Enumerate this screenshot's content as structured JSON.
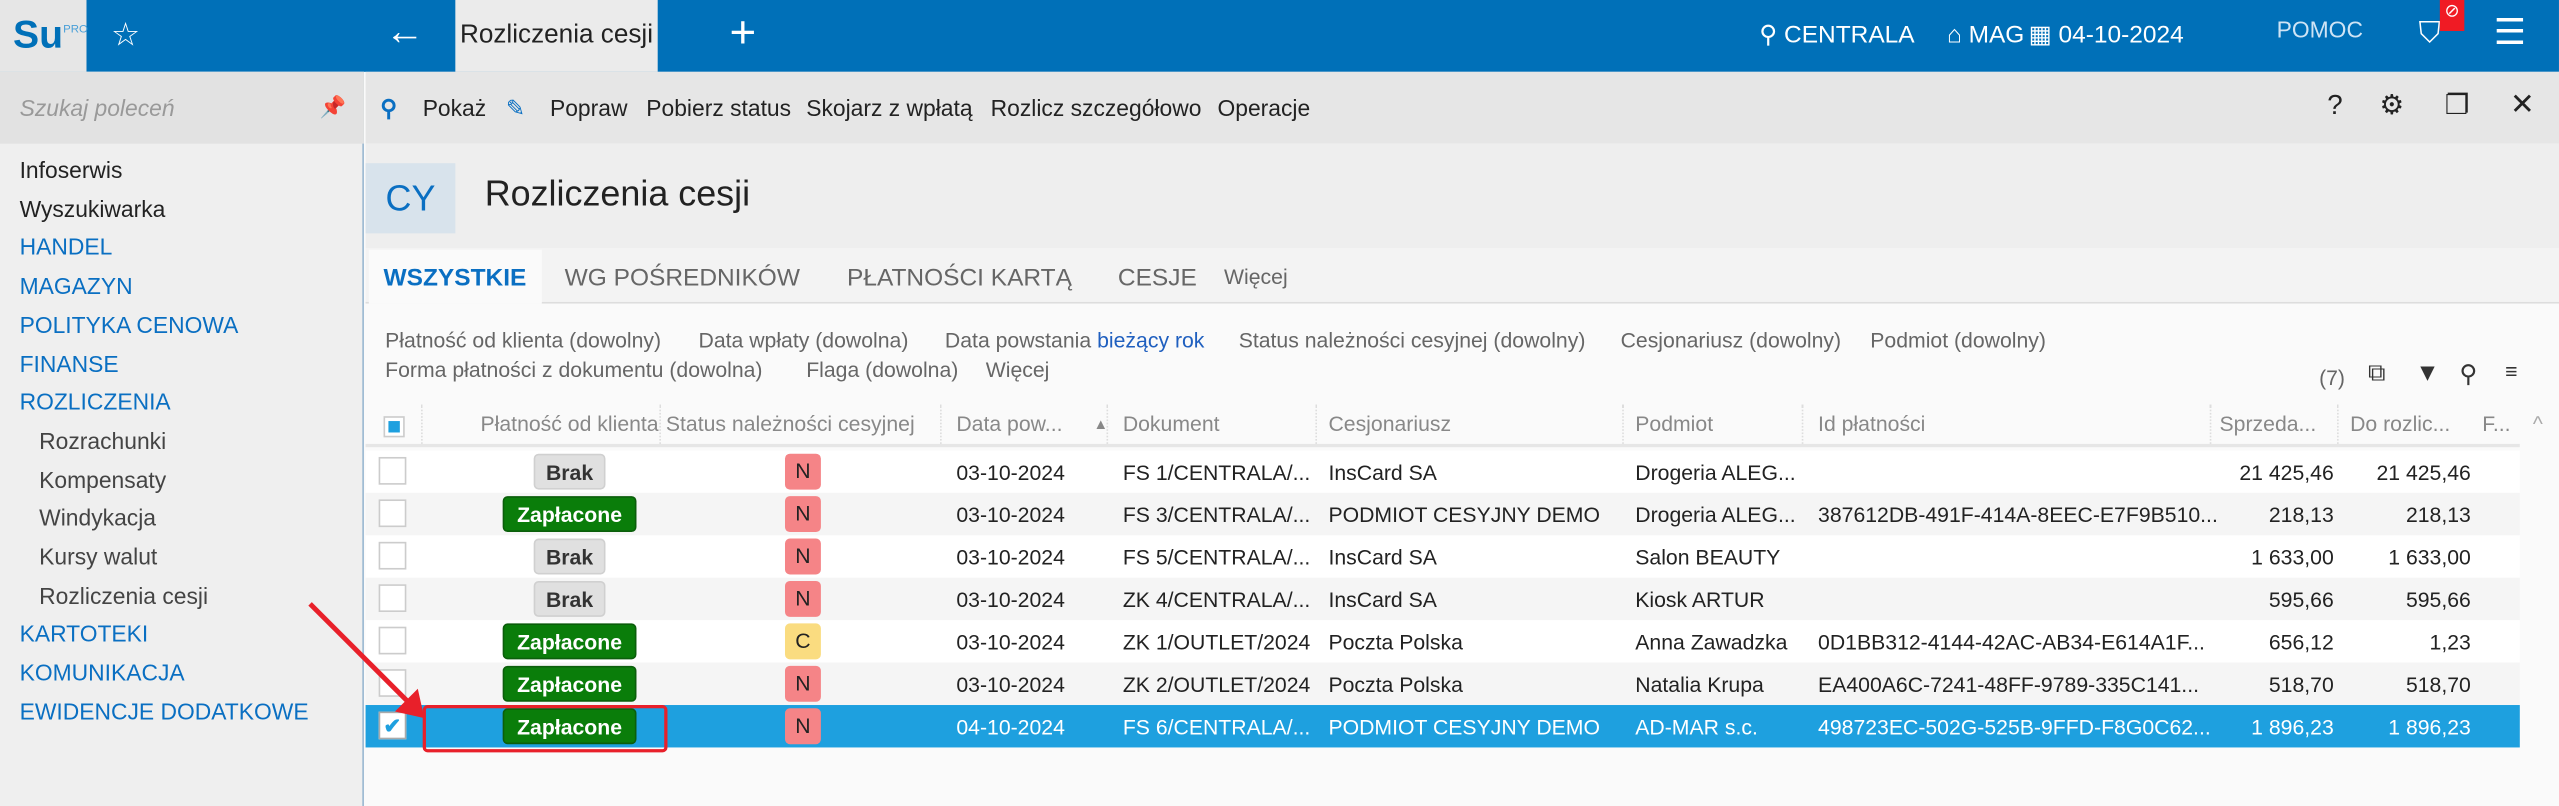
{
  "app": {
    "logo": "Su",
    "logo_sup": "PRO",
    "tab": "Rozliczenia cesji",
    "branch": "CENTRALA",
    "warehouse": "MAG",
    "date": "04-10-2024",
    "help": "POMOC"
  },
  "sidebar": {
    "search_placeholder": "Szukaj poleceń",
    "items": [
      {
        "label": "Infoserwis",
        "type": "plain"
      },
      {
        "label": "Wyszukiwarka",
        "type": "plain"
      },
      {
        "label": "HANDEL",
        "type": "h"
      },
      {
        "label": "MAGAZYN",
        "type": "h"
      },
      {
        "label": "POLITYKA CENOWA",
        "type": "h"
      },
      {
        "label": "FINANSE",
        "type": "h"
      },
      {
        "label": "ROZLICZENIA",
        "type": "h"
      },
      {
        "label": "Rozrachunki",
        "type": "sub"
      },
      {
        "label": "Kompensaty",
        "type": "sub"
      },
      {
        "label": "Windykacja",
        "type": "sub"
      },
      {
        "label": "Kursy walut",
        "type": "sub"
      },
      {
        "label": "Rozliczenia cesji",
        "type": "sub"
      },
      {
        "label": "KARTOTEKI",
        "type": "h"
      },
      {
        "label": "KOMUNIKACJA",
        "type": "h"
      },
      {
        "label": "EWIDENCJE DODATKOWE",
        "type": "h"
      }
    ]
  },
  "toolbar": {
    "show": "Pokaż",
    "edit": "Popraw",
    "fetch_status": "Pobierz status",
    "match": "Skojarz z wpłatą",
    "settle": "Rozlicz szczegółowo",
    "operations": "Operacje"
  },
  "page": {
    "badge": "CY",
    "title": "Rozliczenia cesji"
  },
  "tabs": [
    "WSZYSTKIE",
    "WG POŚREDNIKÓW",
    "PŁATNOŚCI KARTĄ",
    "CESJE",
    "Więcej"
  ],
  "filters": {
    "f1": "Płatność od klienta (dowolny)",
    "f2": "Data wpłaty (dowolna)",
    "f3": "Data powstania",
    "f3v": "bieżący rok",
    "f4": "Status należności cesyjnej (dowolny)",
    "f5": "Cesjonariusz (dowolny)",
    "f6": "Podmiot (dowolny)",
    "f7": "Forma płatności z dokumentu (dowolna)",
    "f8": "Flaga (dowolna)",
    "f9": "Więcej",
    "count": "(7)"
  },
  "columns": [
    "Płatność od klienta",
    "Status należności cesyjnej",
    "Data pow...",
    "Dokument",
    "Cesjonariusz",
    "Podmiot",
    "Id płatności",
    "Sprzeda...",
    "Do rozlic...",
    "F..."
  ],
  "rows": [
    {
      "pay": "Brak",
      "st": "N",
      "date": "03-10-2024",
      "doc": "FS 1/CENTRALA/...",
      "ces": "InsCard SA",
      "pod": "Drogeria ALEG...",
      "id": "",
      "sale": "21 425,46",
      "rest": "21 425,46",
      "checked": false
    },
    {
      "pay": "Zapłacone",
      "st": "N",
      "date": "03-10-2024",
      "doc": "FS 3/CENTRALA/...",
      "ces": "PODMIOT CESYJNY DEMO",
      "pod": "Drogeria ALEG...",
      "id": "387612DB-491F-414A-8EEC-E7F9B510...",
      "sale": "218,13",
      "rest": "218,13",
      "checked": false
    },
    {
      "pay": "Brak",
      "st": "N",
      "date": "03-10-2024",
      "doc": "FS 5/CENTRALA/...",
      "ces": "InsCard SA",
      "pod": "Salon BEAUTY",
      "id": "",
      "sale": "1 633,00",
      "rest": "1 633,00",
      "checked": false
    },
    {
      "pay": "Brak",
      "st": "N",
      "date": "03-10-2024",
      "doc": "ZK 4/CENTRALA/...",
      "ces": "InsCard SA",
      "pod": "Kiosk ARTUR",
      "id": "",
      "sale": "595,66",
      "rest": "595,66",
      "checked": false
    },
    {
      "pay": "Zapłacone",
      "st": "C",
      "date": "03-10-2024",
      "doc": "ZK 1/OUTLET/2024",
      "ces": "Poczta Polska",
      "pod": "Anna Zawadzka",
      "id": "0D1BB312-4144-42AC-AB34-E614A1F...",
      "sale": "656,12",
      "rest": "1,23",
      "checked": false
    },
    {
      "pay": "Zapłacone",
      "st": "N",
      "date": "03-10-2024",
      "doc": "ZK 2/OUTLET/2024",
      "ces": "Poczta Polska",
      "pod": "Natalia Krupa",
      "id": "EA400A6C-7241-48FF-9789-335C141...",
      "sale": "518,70",
      "rest": "518,70",
      "checked": false
    },
    {
      "pay": "Zapłacone",
      "st": "N",
      "date": "04-10-2024",
      "doc": "FS 6/CENTRALA/...",
      "ces": "PODMIOT CESYJNY DEMO",
      "pod": "AD-MAR s.c.",
      "id": "498723EC-502G-525B-9FFD-F8G0C62...",
      "sale": "1 896,23",
      "rest": "1 896,23",
      "checked": true
    }
  ],
  "colors": {
    "brand": "#0070b8",
    "selected": "#1ea0df",
    "paid": "#0a7d0a",
    "none": "#e0e0e0",
    "n": "#f58487",
    "c": "#fadc80",
    "annotation": "#e8202a"
  }
}
